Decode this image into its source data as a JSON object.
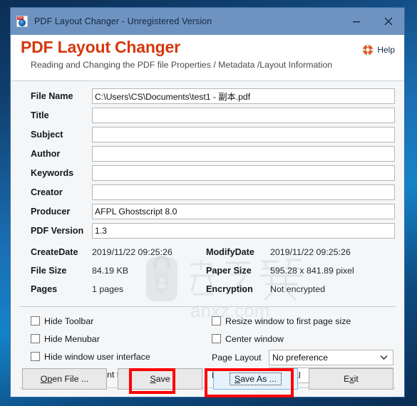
{
  "window": {
    "title": "PDF Layout Changer - Unregistered Version",
    "app_icon": "pdf-globe-icon",
    "minimize_label": "—",
    "close_label": "✕"
  },
  "header": {
    "brand": "PDF Layout Changer",
    "subtitle": "Reading and Changing the PDF file Properties / Metadata /Layout Information",
    "help_label": "Help",
    "help_icon": "life-ring-icon",
    "brand_color": "#d4380d"
  },
  "watermark": {
    "text": "anxz.com",
    "cjk": "安下载"
  },
  "fields": [
    {
      "label": "File Name",
      "value": "C:\\Users\\CS\\Documents\\test1 - 副本.pdf",
      "name": "file-name"
    },
    {
      "label": "Title",
      "value": "",
      "name": "title"
    },
    {
      "label": "Subject",
      "value": "",
      "name": "subject"
    },
    {
      "label": "Author",
      "value": "",
      "name": "author"
    },
    {
      "label": "Keywords",
      "value": "",
      "name": "keywords"
    },
    {
      "label": "Creator",
      "value": "",
      "name": "creator"
    },
    {
      "label": "Producer",
      "value": "AFPL Ghostscript 8.0",
      "name": "producer"
    },
    {
      "label": "PDF Version",
      "value": "1.3",
      "name": "pdf-version"
    }
  ],
  "metadata": [
    {
      "left_label": "CreateDate",
      "left_value": "2019/11/22 09:25:26",
      "right_label": "ModifyDate",
      "right_value": "2019/11/22 09:25:26"
    },
    {
      "left_label": "File Size",
      "left_value": "84.19 KB",
      "right_label": "Paper Size",
      "right_value": "595.28 x 841.89 pixel"
    },
    {
      "left_label": "Pages",
      "left_value": "1 pages",
      "right_label": "Encryption",
      "right_value": "Not encrypted"
    }
  ],
  "options": {
    "left_checkboxes": [
      {
        "label": "Hide Toolbar",
        "checked": false,
        "name": "hide-toolbar"
      },
      {
        "label": "Hide Menubar",
        "checked": false,
        "name": "hide-menubar"
      },
      {
        "label": "Hide window user interface",
        "checked": false,
        "name": "hide-window-user-interface"
      },
      {
        "label": "Display document title",
        "checked": false,
        "name": "display-document-title"
      }
    ],
    "right_checkboxes": [
      {
        "label": "Resize window to first page size",
        "checked": false,
        "name": "resize-window-to-first-page-size"
      },
      {
        "label": "Center window",
        "checked": false,
        "name": "center-window"
      }
    ],
    "page_layout": {
      "label": "Page Layout",
      "value": "No preference"
    },
    "page_mode": {
      "label": "Page Mode",
      "value": "Normal"
    }
  },
  "buttons": {
    "open_file": {
      "pre": "O",
      "accel": "p",
      "post": "en File ..."
    },
    "save": {
      "pre": "",
      "accel": "S",
      "post": "ave"
    },
    "save_as": {
      "pre": "",
      "accel": "S",
      "post": "ave As ..."
    },
    "exit": {
      "pre": "E",
      "accel": "x",
      "post": "it"
    },
    "open_file_text": "Open File ...",
    "save_text": "Save",
    "save_as_text": "Save As ...",
    "exit_text": "Exit"
  },
  "annotations": {
    "highlight_color": "#ff0000",
    "boxes": [
      "save-button",
      "save-as-button"
    ]
  }
}
